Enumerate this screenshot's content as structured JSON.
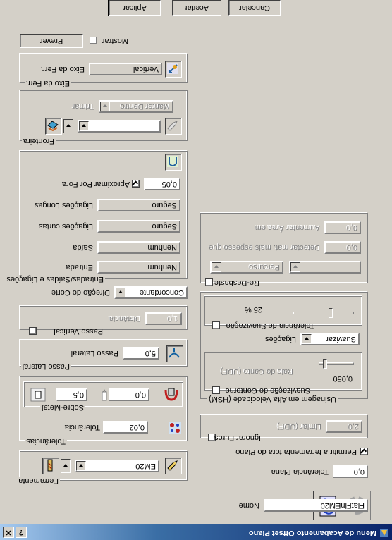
{
  "window": {
    "title": "Menu de Acabamento Offset Plano",
    "help_label": "?",
    "close_label": "✕"
  },
  "name": {
    "label": "Nome",
    "value": "FlatFinEM20"
  },
  "tool": {
    "group_label": "Ferramenta",
    "value": "EM20",
    "icons": [
      "endmill-icon",
      "tool-holder-icon",
      "pencil-icon"
    ]
  },
  "tolerances": {
    "group_label": "Tolerâncias",
    "tolerance_label": "Tolerância",
    "tolerance_value": "0,02",
    "stock_label": "Sobre-Metal",
    "stock_value": "0,0",
    "stock2_value": "0,5"
  },
  "stepover": {
    "group_label": "Passo Lateral",
    "label": "Passo Lateral",
    "value": "5,0"
  },
  "vertical_step": {
    "checkbox_label": "Passo Vertical",
    "distance_label": "Distância",
    "distance_value": "1,0"
  },
  "cut_direction": {
    "label": "Direção do Corte",
    "value": "Concordante"
  },
  "links": {
    "group_label": "Entradas/Saídas e Ligações",
    "entry_label": "Entrada",
    "entry_value": "Nenhum",
    "exit_label": "Saída",
    "exit_value": "Nenhum",
    "short_label": "Ligações curtas",
    "short_value": "Seguro",
    "long_label": "Ligações Longas",
    "long_value": "Seguro",
    "approach_label": "Aproximar Por Fora",
    "approach_value": "0,05",
    "approach_checked": true
  },
  "boundary": {
    "group_label": "Fronteira",
    "value": "",
    "trim_label": "Trimar",
    "trim_value": "Manter Dentro"
  },
  "tool_axis": {
    "group_label": "Eixo da Ferr.",
    "label": "Eixo da Ferr.",
    "value": "Vertical"
  },
  "preview": {
    "button_label": "Prever",
    "show_label": "Mostrar"
  },
  "plane_tolerance": {
    "label": "Tolerância Plana",
    "value": "0,0"
  },
  "allow_outside": {
    "label": "Permitir a ferramenta fora do Plano",
    "checked": true
  },
  "holes": {
    "label": "Ignorar Furos",
    "limit_label": "Limiar (UDF)",
    "limit_value": "2,0"
  },
  "hsm": {
    "group_label": "Usinagem em Alta Velocidade (HSM)",
    "smoothing_label": "Suavização do Contorno",
    "radius_label": "Raio do Canto (UDF)",
    "radius_value": "0,050",
    "links_label": "Ligações",
    "links_value": "Suavizar",
    "tolerance_smoothing_label": "Tolerância de Suavização",
    "tolerance_smoothing_value": "25 %"
  },
  "rest": {
    "checkbox_label": "Re-Desbaste",
    "ref_value": "",
    "type_value": "Percurso",
    "detect_label": "Detectar mat. mais espesso que",
    "detect_value": "0,0",
    "expand_label": "Aumentar Área em",
    "expand_value": "0,0"
  },
  "actions": {
    "apply": "Aplicar",
    "accept": "Aceitar",
    "cancel": "Cancelar"
  },
  "colors": {
    "titlebar": "#0a246a",
    "face": "#d4d0c8"
  }
}
